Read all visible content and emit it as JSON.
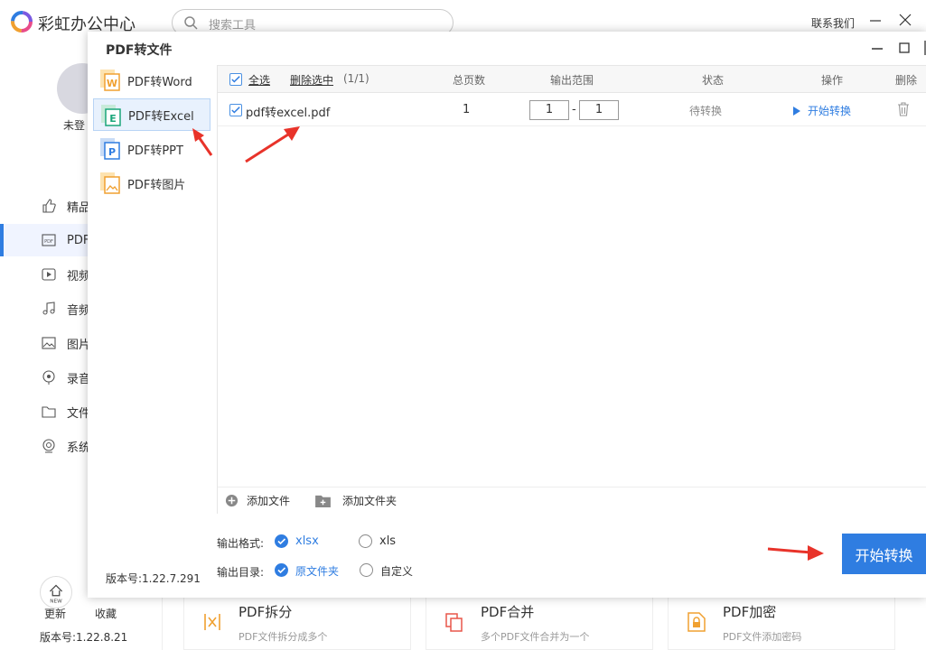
{
  "app": {
    "name": "彩虹办公中心",
    "search_placeholder": "搜索工具",
    "contact": "联系我们",
    "login": "未登",
    "nav": [
      {
        "label": "精品",
        "icon": "thumbs-up-icon"
      },
      {
        "label": "PDF",
        "icon": "pdf-icon"
      },
      {
        "label": "视频",
        "icon": "video-icon"
      },
      {
        "label": "音频",
        "icon": "music-icon"
      },
      {
        "label": "图片",
        "icon": "image-icon"
      },
      {
        "label": "录音",
        "icon": "record-icon"
      },
      {
        "label": "文件",
        "icon": "folder-icon"
      },
      {
        "label": "系统",
        "icon": "system-icon"
      }
    ],
    "update_label": "更新",
    "favorite_label": "收藏",
    "version": "版本号:1.22.8.21",
    "cards": [
      {
        "title": "PDF拆分",
        "desc": "PDF文件拆分成多个"
      },
      {
        "title": "PDF合并",
        "desc": "多个PDF文件合并为一个"
      },
      {
        "title": "PDF加密",
        "desc": "PDF文件添加密码"
      }
    ]
  },
  "dialog": {
    "title": "PDF转文件",
    "modes": [
      {
        "label": "PDF转Word",
        "letter": "W",
        "color": "#f0a030"
      },
      {
        "label": "PDF转Excel",
        "letter": "E",
        "color": "#1aa67a"
      },
      {
        "label": "PDF转PPT",
        "letter": "P",
        "color": "#2f7de1"
      },
      {
        "label": "PDF转图片",
        "letter": "",
        "color": "#f0a030"
      }
    ],
    "version": "版本号:1.22.7.291",
    "table": {
      "select_all": "全选",
      "delete_selected": "删除选中",
      "count": "(1/1)",
      "headers": {
        "pages": "总页数",
        "range": "输出范围",
        "status": "状态",
        "action": "操作",
        "delete": "删除"
      },
      "rows": [
        {
          "filename": "pdf转excel.pdf",
          "pages": "1",
          "range_from": "1",
          "range_sep": "-",
          "range_to": "1",
          "status": "待转换",
          "action": "开始转换"
        }
      ],
      "add_file": "添加文件",
      "add_folder": "添加文件夹"
    },
    "output": {
      "format_label": "输出格式:",
      "format_options": [
        "xlsx",
        "xls"
      ],
      "format_selected": "xlsx",
      "dir_label": "输出目录:",
      "dir_options": [
        "原文件夹",
        "自定义"
      ],
      "dir_selected": "原文件夹"
    },
    "convert_button": "开始转换"
  },
  "colors": {
    "accent": "#2f7de1",
    "arrow": "#e8332a"
  }
}
